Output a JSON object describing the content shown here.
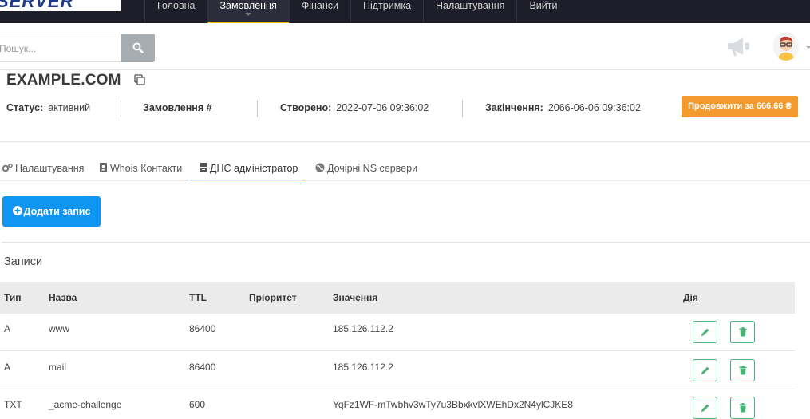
{
  "logo": {
    "text": "SERVER"
  },
  "nav": {
    "items": [
      {
        "label": "Головна"
      },
      {
        "label": "Замовлення"
      },
      {
        "label": "Фінанси"
      },
      {
        "label": "Підтримка"
      },
      {
        "label": "Налаштування"
      },
      {
        "label": "Вийти"
      }
    ],
    "active_index": 1
  },
  "search": {
    "placeholder": "Пошук..."
  },
  "domain": {
    "name": "EXAMPLE.COM",
    "status_label": "Статус:",
    "status_value": "активний",
    "order_label": "Замовлення #",
    "created_label": "Створено:",
    "created_value": "2022-07-06 09:36:02",
    "expires_label": "Закінчення:",
    "expires_value": "2066-06-06 09:36:02",
    "renew_label": "Продовжити за 666.66 ₴"
  },
  "tabs": [
    {
      "label": "Налаштування",
      "icon": "gears-icon"
    },
    {
      "label": "Whois Контакти",
      "icon": "address-book-icon"
    },
    {
      "label": "ДНС адміністратор",
      "icon": "server-icon"
    },
    {
      "label": "Дочірні NS сервери",
      "icon": "globe-icon"
    }
  ],
  "add_record_label": "Додати запис",
  "records_title": "Записи",
  "table": {
    "headers": {
      "type": "Тип",
      "name": "Назва",
      "ttl": "TTL",
      "priority": "Пріоритет",
      "value": "Значення",
      "action": "Дія"
    },
    "rows": [
      {
        "type": "A",
        "name": "www",
        "ttl": "86400",
        "priority": "",
        "value": "185.126.112.2"
      },
      {
        "type": "A",
        "name": "mail",
        "ttl": "86400",
        "priority": "",
        "value": "185.126.112.2"
      },
      {
        "type": "TXT",
        "name": "_acme-challenge",
        "ttl": "600",
        "priority": "",
        "value": "YqFz1WF-mTwbhv3wTy7u3BbxkvlXWEhDx2N4ylCJKE8"
      }
    ]
  },
  "colors": {
    "topbar": "#1e1e2a",
    "active_tab_underline": "#f2c200",
    "renew_button": "#f29a2e",
    "add_button": "#0f95f2",
    "action_button_border": "#47b377"
  }
}
